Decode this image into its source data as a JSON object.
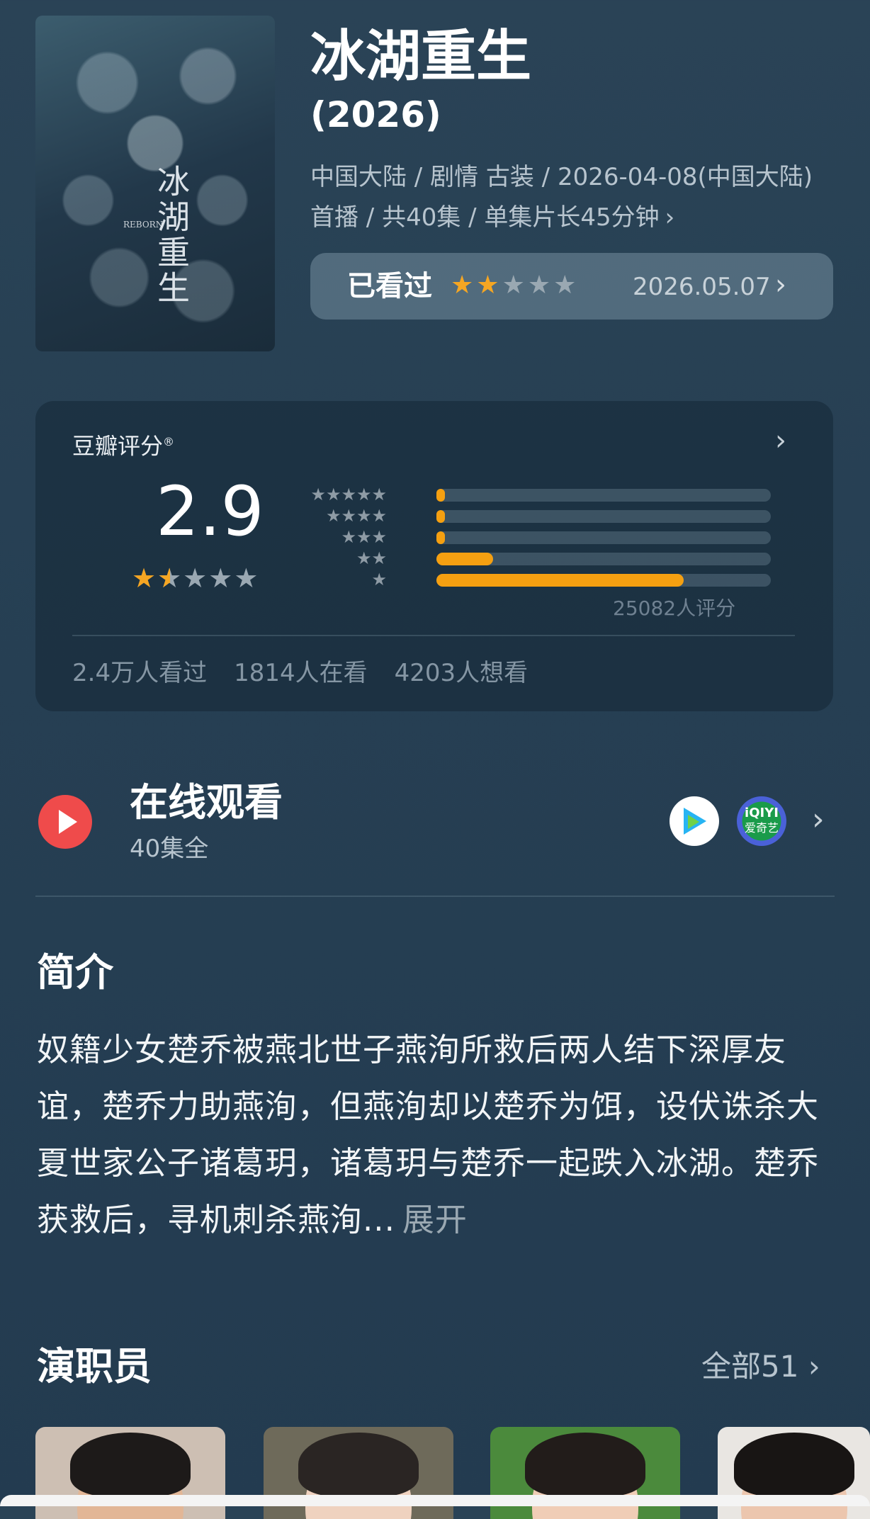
{
  "header": {
    "title": "冰湖重生",
    "year": "(2026)",
    "meta": "中国大陆 / 剧情 古装 / 2026-04-08(中国大陆)首播 / 共40集 / 单集片长45分钟",
    "meta_arrow": "›",
    "poster_title": "冰湖重生",
    "poster_subtitle": "REBORN"
  },
  "my_rating": {
    "status": "已看过",
    "stars_given": 2,
    "stars_total": 5,
    "date": "2026.05.07",
    "chevron": "›"
  },
  "douban": {
    "label": "豆瓣评分",
    "label_mark": "®",
    "score": "2.9",
    "score_stars": 1.5,
    "distribution": [
      {
        "stars": "★★★★★",
        "percent": 2
      },
      {
        "stars": "★★★★",
        "percent": 2
      },
      {
        "stars": "★★★",
        "percent": 2
      },
      {
        "stars": "★★",
        "percent": 17
      },
      {
        "stars": "★",
        "percent": 74
      }
    ],
    "rating_count": "25082人评分",
    "stats": [
      "2.4万人看过",
      "1814人在看",
      "4203人想看"
    ]
  },
  "watch_online": {
    "title": "在线观看",
    "subtitle": "40集全",
    "platforms": [
      {
        "name": "tencent-video",
        "icon": "tencent-video-icon"
      },
      {
        "name": "iqiyi",
        "icon": "iqiyi-icon",
        "label_top": "iQIYI",
        "label_bottom": "爱奇艺"
      }
    ],
    "colors": {
      "play": "#ef4b4b",
      "iqiyi": "#1a9b4a"
    }
  },
  "intro": {
    "heading": "简介",
    "text": "奴籍少女楚乔被燕北世子燕洵所救后两人结下深厚友谊，楚乔力助燕洵，但燕洵却以楚乔为饵，设伏诛杀大夏世家公子诸葛玥，诸葛玥与楚乔一起跌入冰湖。楚乔获救后，寻机刺杀燕洵...",
    "expand": "展开"
  },
  "cast": {
    "heading": "演职员",
    "all": "全部51",
    "chevron": "›"
  },
  "colors": {
    "accent_star": "#f5a623",
    "bar_fill": "#f5a011",
    "background": "#263f53"
  }
}
